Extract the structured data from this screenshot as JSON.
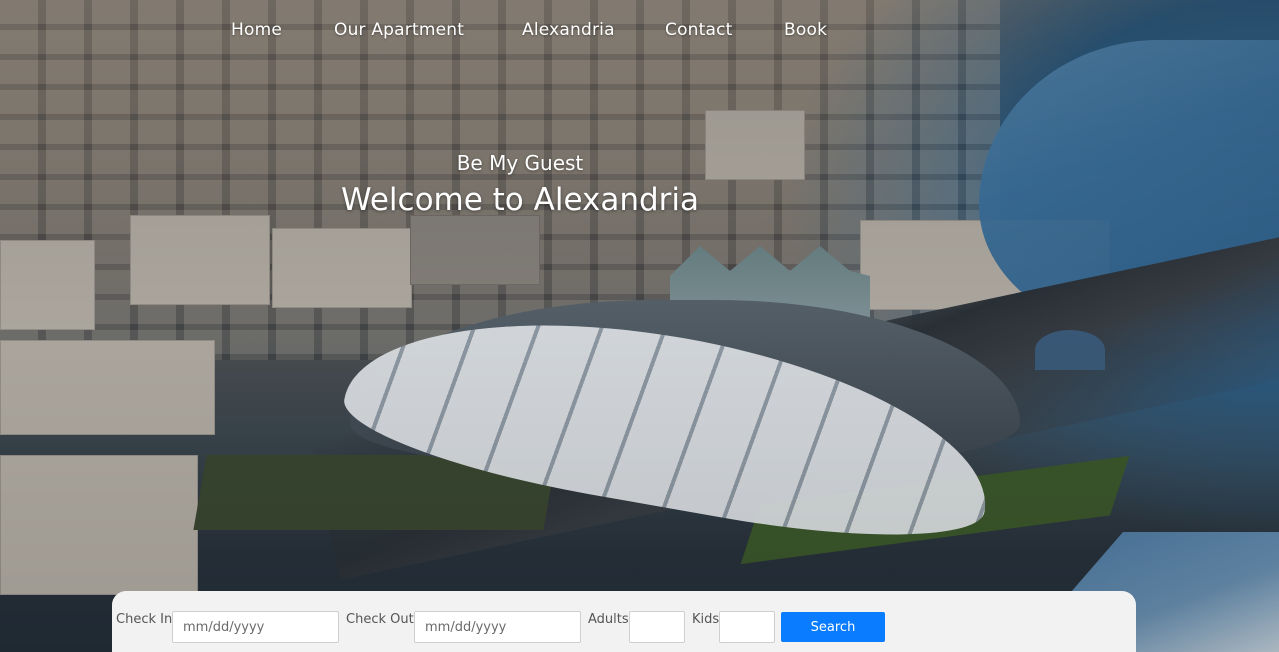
{
  "nav": {
    "items": [
      {
        "label": "Home"
      },
      {
        "label": "Our Apartment"
      },
      {
        "label": "Alexandria"
      },
      {
        "label": "Contact"
      },
      {
        "label": "Book"
      }
    ]
  },
  "hero": {
    "subtitle": "Be My Guest",
    "title": "Welcome to Alexandria"
  },
  "booking": {
    "check_in_label": "Check In",
    "check_in_placeholder": "mm/dd/yyyy",
    "check_out_label": "Check Out",
    "check_out_placeholder": "mm/dd/yyyy",
    "adults_label": "Adults",
    "kids_label": "Kids",
    "search_label": "Search"
  },
  "colors": {
    "accent": "#0a7cff",
    "booking_bar": "#f2f2f2",
    "nav_text": "#ffffff"
  }
}
